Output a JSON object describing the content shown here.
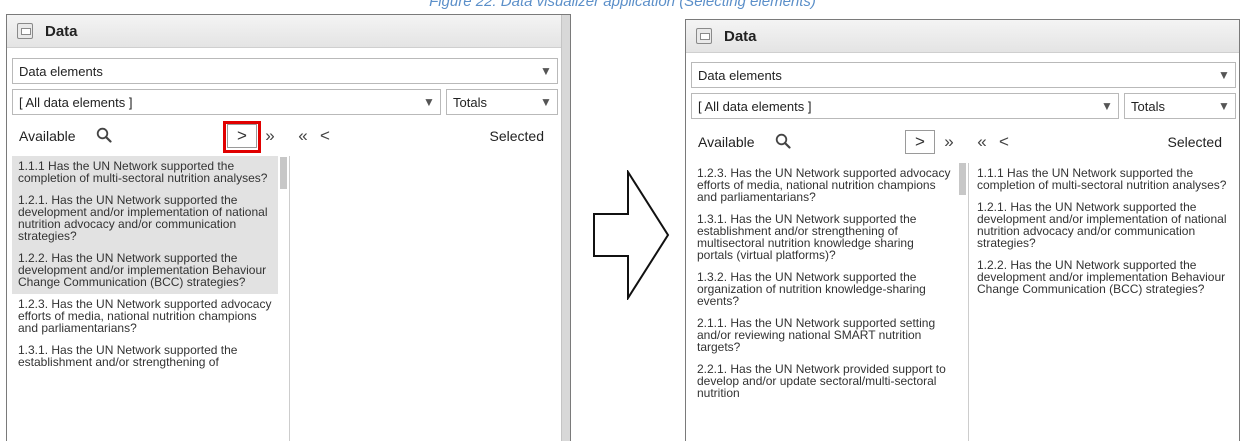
{
  "caption": "Figure 22: Data visualizer application (Selecting elements)",
  "panel_title": "Data",
  "type_select": "Data elements",
  "group_select": "[ All data elements ]",
  "total_select": "Totals",
  "available_label": "Available",
  "selected_label": "Selected",
  "buttons": {
    "select_one": ">",
    "select_all": "»",
    "deselect_all": "«",
    "deselect_one": "<"
  },
  "icons": {
    "search": "search-icon",
    "data": "data-icon",
    "dropdown": "chevron-down-icon",
    "arrow": "right-arrow-icon"
  },
  "colors": {
    "highlight": "#e00000",
    "caption": "#5b8fc9"
  },
  "before": {
    "available": [
      "1.1.1 Has the UN Network supported the completion of multi-sectoral nutrition analyses?",
      "1.2.1. Has the UN Network supported the development and/or implementation of national nutrition advocacy and/or communication strategies?",
      "1.2.2. Has the UN Network supported the development and/or implementation Behaviour Change Communication (BCC) strategies?",
      "1.2.3. Has the UN Network supported advocacy efforts of media, national nutrition champions and parliamentarians?",
      "1.3.1. Has the UN Network supported the establishment and/or strengthening of"
    ],
    "selected": []
  },
  "after": {
    "available": [
      "1.2.3. Has the UN Network supported advocacy efforts of media, national nutrition champions and parliamentarians?",
      "1.3.1. Has the UN Network supported the establishment and/or strengthening of multisectoral nutrition knowledge sharing portals (virtual platforms)?",
      "1.3.2. Has the UN Network supported the organization of nutrition knowledge-sharing events?",
      "2.1.1. Has the UN Network supported setting and/or reviewing national SMART nutrition targets?",
      "2.2.1. Has the UN Network provided support to develop and/or update sectoral/multi-sectoral nutrition"
    ],
    "selected": [
      "1.1.1 Has the UN Network supported the completion of multi-sectoral nutrition analyses?",
      "1.2.1. Has the UN Network supported the development and/or implementation of national nutrition advocacy and/or communication strategies?",
      "1.2.2. Has the UN Network supported the development and/or implementation Behaviour Change Communication (BCC) strategies?"
    ]
  }
}
